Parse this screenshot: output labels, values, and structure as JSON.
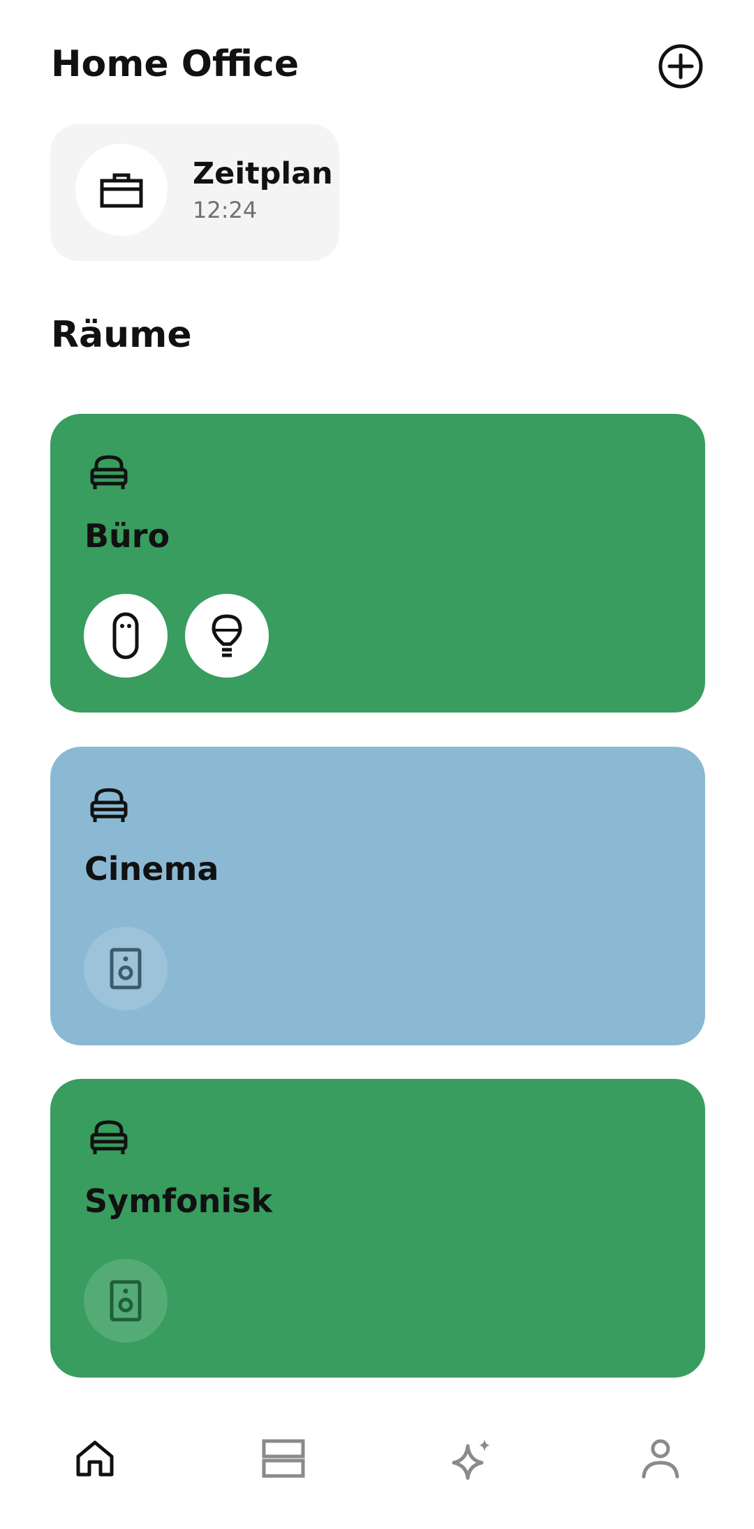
{
  "header": {
    "title": "Home Office",
    "add_icon": "add-circle-icon"
  },
  "schedule": {
    "title": "Zeitplan",
    "time": "12:24",
    "icon": "briefcase-icon"
  },
  "rooms_section": {
    "title": "Räume"
  },
  "rooms": [
    {
      "name": "Büro",
      "icon": "sofa-icon",
      "color": "#389d5e",
      "devices": [
        {
          "icon": "remote-icon",
          "state": "on"
        },
        {
          "icon": "lightbulb-icon",
          "state": "on"
        }
      ]
    },
    {
      "name": "Cinema",
      "icon": "sofa-icon",
      "color": "#8bb9d4",
      "devices": [
        {
          "icon": "speaker-icon",
          "state": "off"
        }
      ]
    },
    {
      "name": "Symfonisk",
      "icon": "sofa-icon",
      "color": "#389d5e",
      "devices": [
        {
          "icon": "speaker-icon",
          "state": "off"
        }
      ]
    }
  ],
  "nav": [
    {
      "icon": "home-icon",
      "active": true
    },
    {
      "icon": "rooms-icon",
      "active": false
    },
    {
      "icon": "sparkle-icon",
      "active": false
    },
    {
      "icon": "profile-icon",
      "active": false
    }
  ],
  "colors": {
    "active_icon": "#111111",
    "inactive_icon": "#8a8a8a",
    "card_bg": "#f4f4f4"
  }
}
